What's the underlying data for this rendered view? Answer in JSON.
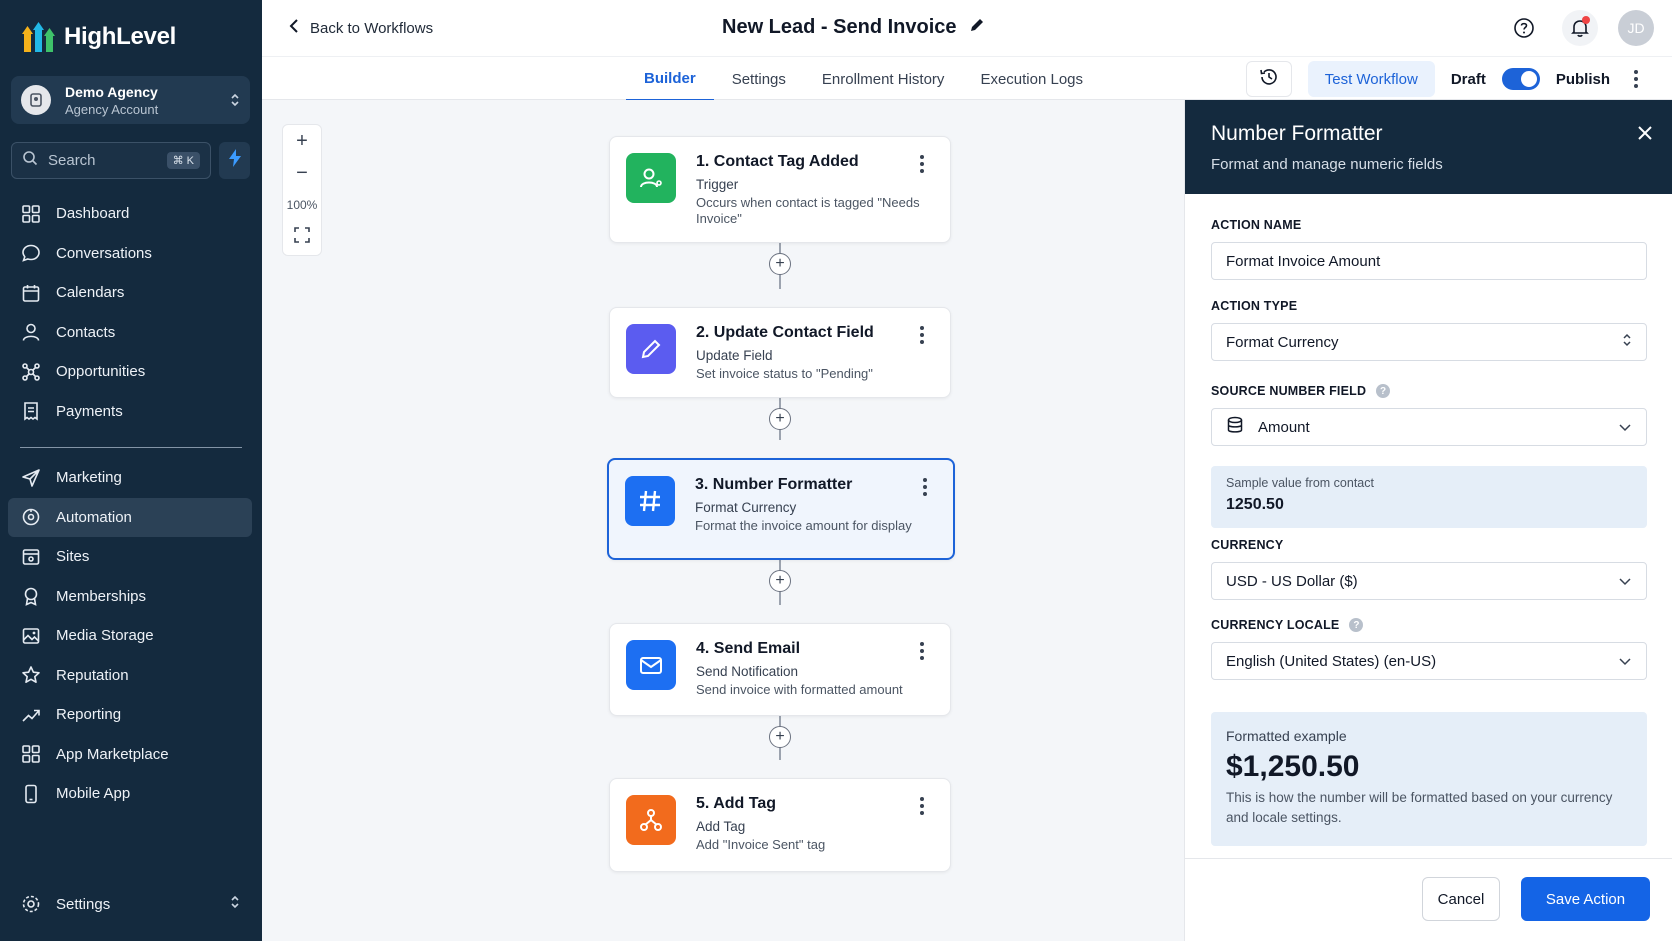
{
  "app": {
    "brand": "HighLevel",
    "agency_name": "Demo Agency",
    "agency_sub": "Agency Account",
    "search_placeholder": "Search",
    "search_shortcut": "⌘ K",
    "accent": "#1d63d8",
    "sidebar_bg": "#142a3e"
  },
  "nav_primary": [
    {
      "label": "Dashboard",
      "icon": "grid-icon"
    },
    {
      "label": "Conversations",
      "icon": "chat-icon"
    },
    {
      "label": "Calendars",
      "icon": "calendar-icon"
    },
    {
      "label": "Contacts",
      "icon": "user-icon"
    },
    {
      "label": "Opportunities",
      "icon": "opportunities-icon"
    },
    {
      "label": "Payments",
      "icon": "receipt-icon"
    }
  ],
  "nav_secondary": [
    {
      "label": "Marketing",
      "icon": "send-icon"
    },
    {
      "label": "Automation",
      "icon": "automation-icon",
      "active": true
    },
    {
      "label": "Sites",
      "icon": "sites-icon"
    },
    {
      "label": "Memberships",
      "icon": "badge-icon"
    },
    {
      "label": "Media Storage",
      "icon": "image-icon"
    },
    {
      "label": "Reputation",
      "icon": "star-icon"
    },
    {
      "label": "Reporting",
      "icon": "trend-icon"
    },
    {
      "label": "App Marketplace",
      "icon": "apps-icon"
    },
    {
      "label": "Mobile App",
      "icon": "phone-icon"
    }
  ],
  "settings_label": "Settings",
  "header": {
    "back_label": "Back to Workflows",
    "title": "New Lead - Send Invoice",
    "avatar_initials": "JD"
  },
  "tabs": [
    {
      "label": "Builder",
      "active": true
    },
    {
      "label": "Settings"
    },
    {
      "label": "Enrollment History"
    },
    {
      "label": "Execution Logs"
    }
  ],
  "actions": {
    "test_workflow": "Test Workflow",
    "draft": "Draft",
    "publish": "Publish"
  },
  "zoom": {
    "level": "100%"
  },
  "nodes": [
    {
      "title": "1. Contact Tag Added",
      "type": "Trigger",
      "desc": "Occurs when contact is tagged \"Needs Invoice\"",
      "icon": "contact-icon",
      "color": "#22b35e"
    },
    {
      "title": "2. Update Contact Field",
      "type": "Update Field",
      "desc": "Set invoice status to \"Pending\"",
      "icon": "pencil-icon",
      "color": "#5b5cf0"
    },
    {
      "title": "3. Number Formatter",
      "type": "Format Currency",
      "desc": "Format the invoice amount for display",
      "icon": "hash-icon",
      "color": "#1d6ff2"
    },
    {
      "title": "4. Send Email",
      "type": "Send Notification",
      "desc": "Send invoice with formatted amount",
      "icon": "mail-icon",
      "color": "#1d6ff2"
    },
    {
      "title": "5. Add Tag",
      "type": "Add Tag",
      "desc": "Add \"Invoice Sent\" tag",
      "icon": "tag-branch-icon",
      "color": "#f26b1d"
    }
  ],
  "panel": {
    "title": "Number Formatter",
    "subtitle": "Format and manage numeric fields",
    "action_name_label": "ACTION NAME",
    "action_name_value": "Format Invoice Amount",
    "action_type_label": "ACTION TYPE",
    "action_type_value": "Format Currency",
    "source_label": "SOURCE NUMBER FIELD",
    "source_value": "Amount",
    "sample_label": "Sample value from contact",
    "sample_value": "1250.50",
    "currency_label": "CURRENCY",
    "currency_value": "USD - US Dollar ($)",
    "locale_label": "CURRENCY LOCALE",
    "locale_value": "English (United States) (en-US)",
    "example_label": "Formatted example",
    "example_value": "$1,250.50",
    "example_note": "This is how the number will be formatted based on your currency and locale settings.",
    "cancel": "Cancel",
    "save": "Save Action"
  }
}
